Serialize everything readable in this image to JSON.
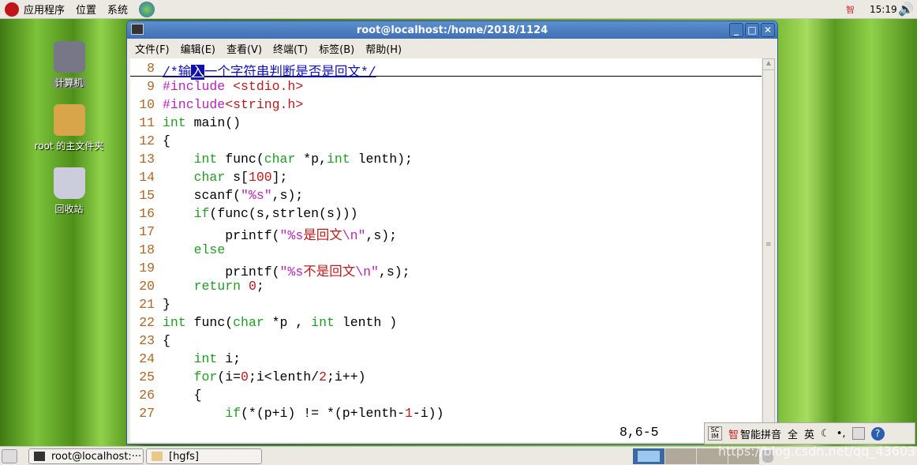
{
  "top_panel": {
    "menus": [
      "应用程序",
      "位置",
      "系统"
    ],
    "clock": "15:19",
    "ime_tray": "智"
  },
  "desktop": {
    "icons": [
      "计算机",
      "root 的主文件夹",
      "回收站"
    ]
  },
  "window": {
    "title": "root@localhost:/home/2018/1124",
    "menu": [
      "文件(F)",
      "编辑(E)",
      "查看(V)",
      "终端(T)",
      "标签(B)",
      "帮助(H)"
    ],
    "status": "8,6-5",
    "lines": [
      {
        "n": "8",
        "seg": [
          [
            "/*输",
            "cm"
          ],
          [
            "入",
            "cur"
          ],
          [
            "一个字符串判断是否是回文*/",
            "cm"
          ]
        ]
      },
      {
        "n": "9",
        "seg": [
          [
            "#include ",
            "pp"
          ],
          [
            "<stdio.h>",
            "inc"
          ]
        ]
      },
      {
        "n": "10",
        "seg": [
          [
            "#include",
            "pp"
          ],
          [
            "<string.h>",
            "inc"
          ]
        ]
      },
      {
        "n": "11",
        "seg": [
          [
            "int",
            "k"
          ],
          [
            " main()",
            ""
          ]
        ]
      },
      {
        "n": "12",
        "seg": [
          [
            "{",
            ""
          ]
        ]
      },
      {
        "n": "13",
        "seg": [
          [
            "    ",
            ""
          ],
          [
            "int",
            "k"
          ],
          [
            " func(",
            ""
          ],
          [
            "char",
            "k"
          ],
          [
            " *p,",
            ""
          ],
          [
            "int",
            "k"
          ],
          [
            " lenth);",
            ""
          ]
        ]
      },
      {
        "n": "14",
        "seg": [
          [
            "    ",
            ""
          ],
          [
            "char",
            "k"
          ],
          [
            " s[",
            ""
          ],
          [
            "100",
            "cn"
          ],
          [
            "];",
            ""
          ]
        ]
      },
      {
        "n": "15",
        "seg": [
          [
            "    scanf(",
            ""
          ],
          [
            "\"%s\"",
            "st"
          ],
          [
            ",s);",
            ""
          ]
        ]
      },
      {
        "n": "16",
        "seg": [
          [
            "    ",
            ""
          ],
          [
            "if",
            "k"
          ],
          [
            "(func(s,strlen(s)))",
            ""
          ]
        ]
      },
      {
        "n": "17",
        "seg": [
          [
            "        printf(",
            ""
          ],
          [
            "\"%s",
            "st"
          ],
          [
            "是回文",
            "cn"
          ],
          [
            "\\n\"",
            "st"
          ],
          [
            ",s);",
            ""
          ]
        ]
      },
      {
        "n": "18",
        "seg": [
          [
            "    ",
            ""
          ],
          [
            "else",
            "k"
          ]
        ]
      },
      {
        "n": "19",
        "seg": [
          [
            "        printf(",
            ""
          ],
          [
            "\"%s",
            "st"
          ],
          [
            "不是回文",
            "cn"
          ],
          [
            "\\n\"",
            "st"
          ],
          [
            ",s);",
            ""
          ]
        ]
      },
      {
        "n": "20",
        "seg": [
          [
            "    ",
            ""
          ],
          [
            "return",
            "k"
          ],
          [
            " ",
            ""
          ],
          [
            "0",
            "cn"
          ],
          [
            ";",
            ""
          ]
        ]
      },
      {
        "n": "21",
        "seg": [
          [
            "}",
            ""
          ]
        ]
      },
      {
        "n": "22",
        "seg": [
          [
            "int",
            "k"
          ],
          [
            " func(",
            ""
          ],
          [
            "char",
            "k"
          ],
          [
            " *p , ",
            ""
          ],
          [
            "int",
            "k"
          ],
          [
            " lenth )",
            ""
          ]
        ]
      },
      {
        "n": "23",
        "seg": [
          [
            "{",
            ""
          ]
        ]
      },
      {
        "n": "24",
        "seg": [
          [
            "    ",
            ""
          ],
          [
            "int",
            "k"
          ],
          [
            " i;",
            ""
          ]
        ]
      },
      {
        "n": "25",
        "seg": [
          [
            "    ",
            ""
          ],
          [
            "for",
            "k"
          ],
          [
            "(i=",
            ""
          ],
          [
            "0",
            "cn"
          ],
          [
            ";i<lenth/",
            ""
          ],
          [
            "2",
            "cn"
          ],
          [
            ";i++)",
            ""
          ]
        ]
      },
      {
        "n": "26",
        "seg": [
          [
            "    {",
            ""
          ]
        ]
      },
      {
        "n": "27",
        "seg": [
          [
            "        ",
            ""
          ],
          [
            "if",
            "k"
          ],
          [
            "(*(p+i) != *(p+lenth-",
            ""
          ],
          [
            "1",
            "cn"
          ],
          [
            "-i))",
            ""
          ]
        ]
      }
    ]
  },
  "ime": {
    "logo": "SC IM",
    "mode": "智",
    "name": "智能拼音",
    "full": "全",
    "lang": "英"
  },
  "taskbar": {
    "items": [
      "root@localhost:···",
      "[hgfs]"
    ]
  },
  "watermark": "https://blog.csdn.net/qq_43603963"
}
